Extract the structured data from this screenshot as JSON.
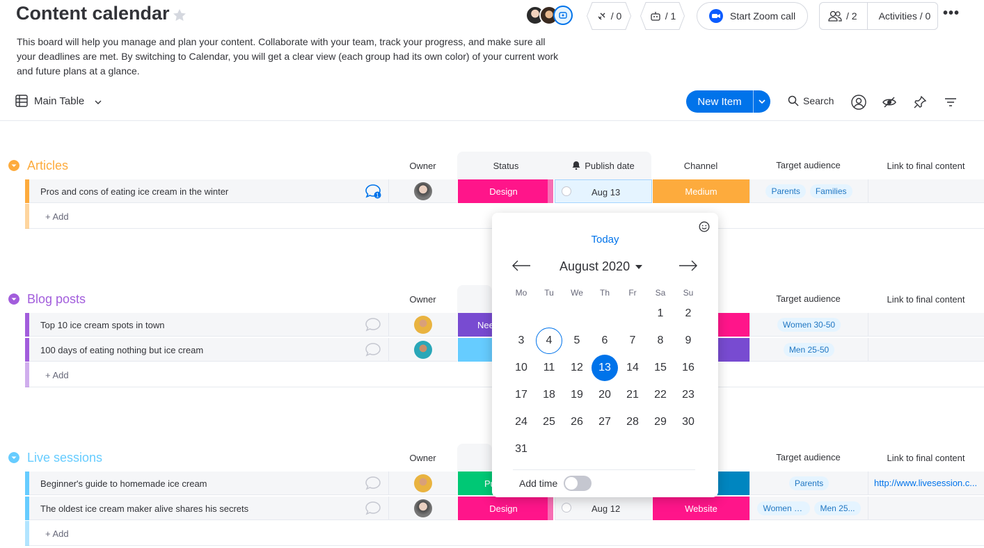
{
  "header": {
    "title": "Content calendar",
    "description": "This board will help you manage and plan your content. Collaborate with your team, track your progress, and make sure all your deadlines are met. By switching to Calendar, you will get a clear view (each group had its own color) of your current work and future plans at a glance.",
    "integrations_count": "/ 0",
    "automations_count": "/ 1",
    "zoom_label": "Start Zoom call",
    "members_count": "/ 2",
    "activities_label": "Activities / 0",
    "more_label": "•••"
  },
  "toolbar": {
    "view_label": "Main Table",
    "new_item_label": "New Item",
    "search_label": "Search"
  },
  "columns": {
    "owner": "Owner",
    "status": "Status",
    "publish_date": "Publish date",
    "channel": "Channel",
    "target_audience": "Target audience",
    "link": "Link to final content"
  },
  "groups": [
    {
      "title": "Articles",
      "color": "#fdab3d",
      "add_label": "+ Add",
      "rows": [
        {
          "name": "Pros and cons of eating ice cream in the winter",
          "comments": "1",
          "status": "Design",
          "status_color": "#ff158a",
          "date": "Aug 13",
          "channel": "Medium",
          "channel_color": "#fdab3d",
          "audience": [
            "Parents",
            "Families"
          ],
          "link": ""
        }
      ]
    },
    {
      "title": "Blog posts",
      "color": "#a25ddc",
      "add_label": "+ Add",
      "rows": [
        {
          "name": "Top 10 ice cream spots in town",
          "status": "Nee",
          "status_color": "#784bd1",
          "channel_color": "#ff158a",
          "audience": [
            "Women 30-50"
          ],
          "link": ""
        },
        {
          "name": "100 days of eating nothing but ice cream",
          "status": "",
          "status_color": "#66ccff",
          "channel_color": "#784bd1",
          "audience": [
            "Men 25-50"
          ],
          "link": ""
        }
      ]
    },
    {
      "title": "Live sessions",
      "color": "#66ccff",
      "add_label": "+ Add",
      "rows": [
        {
          "name": "Beginner's guide to homemade ice cream",
          "status": "Pu",
          "status_color": "#00c875",
          "channel_color": "#0086c0",
          "audience": [
            "Parents"
          ],
          "link": "http://www.livesession.c..."
        },
        {
          "name": "The oldest ice cream maker alive shares his secrets",
          "status": "Design",
          "status_color": "#ff158a",
          "date": "Aug 12",
          "channel": "Website",
          "channel_color": "#ff158a",
          "audience": [
            "Women 30...",
            "Men 25..."
          ],
          "link": ""
        }
      ]
    }
  ],
  "calendar": {
    "today_label": "Today",
    "month_label": "August 2020",
    "weekdays": [
      "Mo",
      "Tu",
      "We",
      "Th",
      "Fr",
      "Sa",
      "Su"
    ],
    "days": [
      "1",
      "2",
      "3",
      "4",
      "5",
      "6",
      "7",
      "8",
      "9",
      "10",
      "11",
      "12",
      "13",
      "14",
      "15",
      "16",
      "17",
      "18",
      "19",
      "20",
      "21",
      "22",
      "23",
      "24",
      "25",
      "26",
      "27",
      "28",
      "29",
      "30",
      "31"
    ],
    "today_day": "4",
    "selected_day": "13",
    "add_time_label": "Add time",
    "add_time_on": false
  }
}
